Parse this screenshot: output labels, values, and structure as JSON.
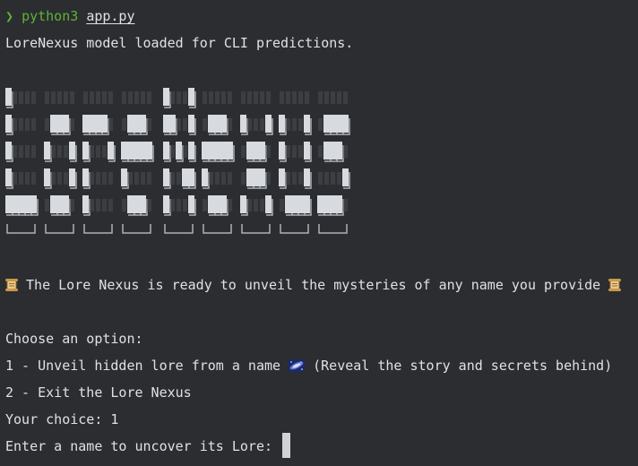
{
  "prompt": {
    "symbol": "❯",
    "command": "python3",
    "argument": "app.py"
  },
  "status_line": "LoreNexus model loaded for CLI predictions.",
  "banner": {
    "text": "LoreNexus",
    "style": "ANSI Shadow block-letter ASCII art"
  },
  "intro_line": "The Lore Nexus is ready to unveil the mysteries of any name you provide",
  "menu": {
    "heading": "Choose an option:",
    "option_1": "1 - Unveil hidden lore from a name",
    "option_1_suffix": "(Reveal the story and secrets behind)",
    "option_2": "2 - Exit the Lore Nexus"
  },
  "choice_line": "Your choice: 1",
  "name_prompt": "Enter a name to uncover its Lore:",
  "icons": {
    "intro_left": "scroll-icon",
    "intro_right": "scroll-icon",
    "option_1": "milky-way-icon"
  },
  "colors": {
    "background": "#2b2d30",
    "text": "#dfe1e5",
    "command": "#5fb236"
  }
}
